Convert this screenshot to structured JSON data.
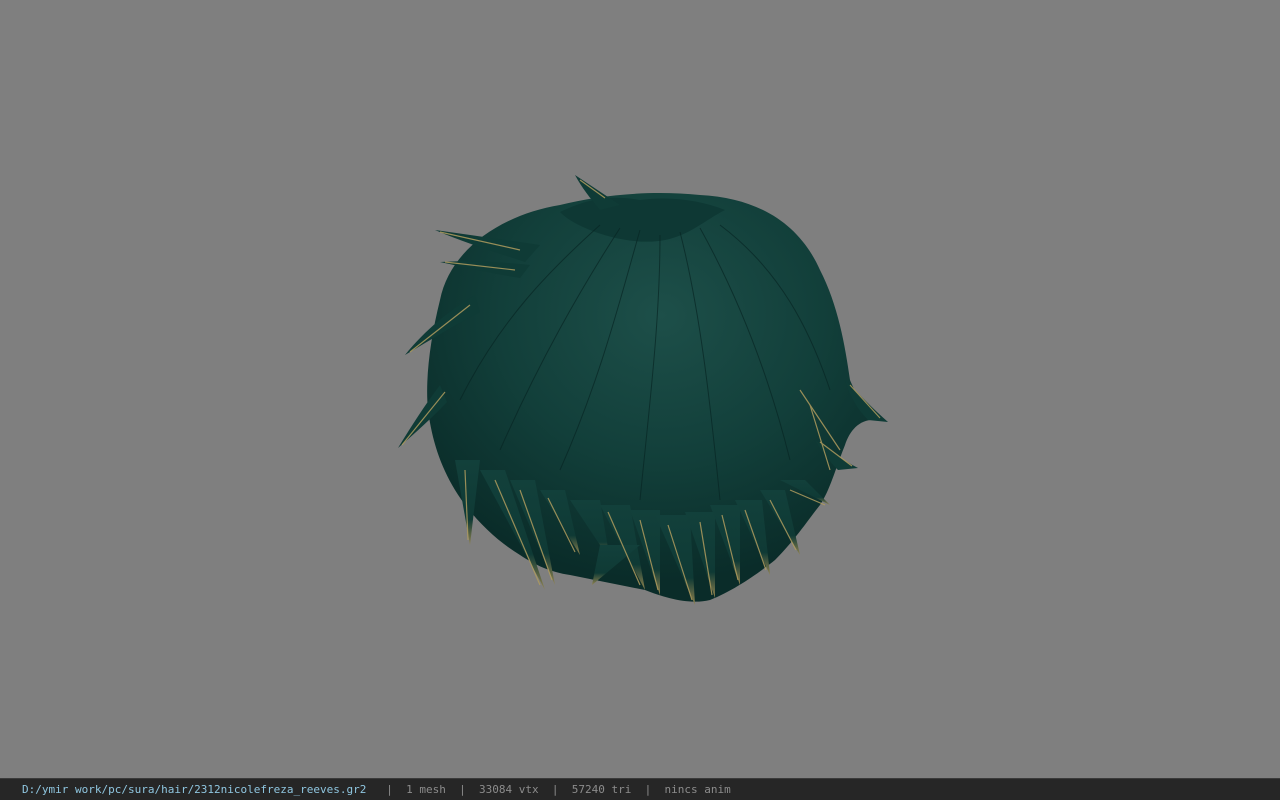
{
  "viewport": {
    "background": "#7f7f7f",
    "model": {
      "name": "hair-mesh",
      "base_color": "#0f3b36",
      "tip_color": "#a8945a"
    }
  },
  "statusbar": {
    "file_path": "D:/ymir work/pc/sura/hair/2312nicolefreza_reeves.gr2",
    "separator": "|",
    "mesh_count": "1 mesh",
    "vertex_count": "33084 vtx",
    "triangle_count": "57240 tri",
    "anim_status": "nincs anim",
    "path_color": "#8fc6e0",
    "text_color": "#8c8c8c"
  }
}
